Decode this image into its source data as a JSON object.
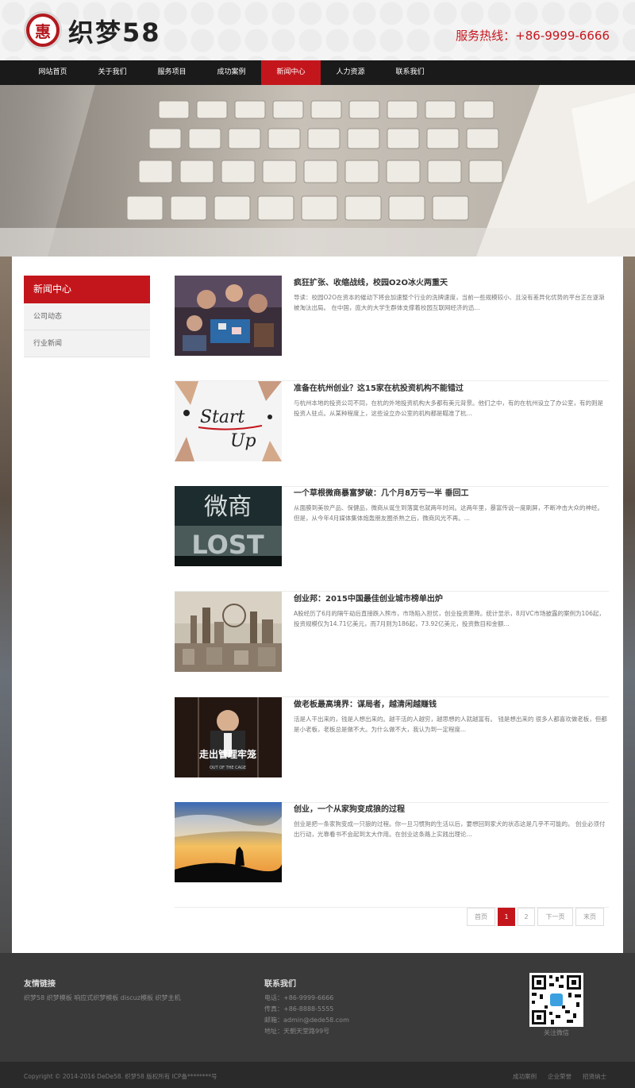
{
  "header": {
    "logo_glyph": "惠",
    "logo_text": "织梦58",
    "hotline": "服务热线：+86-9999-6666"
  },
  "nav": [
    {
      "label": "网站首页"
    },
    {
      "label": "关于我们"
    },
    {
      "label": "服务项目"
    },
    {
      "label": "成功案例"
    },
    {
      "label": "新闻中心",
      "active": true
    },
    {
      "label": "人力资源"
    },
    {
      "label": "联系我们"
    }
  ],
  "sidebar": {
    "title": "新闻中心",
    "items": [
      {
        "label": "公司动态"
      },
      {
        "label": "行业新闻"
      }
    ]
  },
  "news": [
    {
      "title": "疯狂扩张、收缩战线，校园O2O冰火两重天",
      "summary": "导读：校园O2O在资本的催动下将会加速整个行业的洗牌速度，当前一些规模较小、且没有差异化优势的平台正在逐渐被淘汰出局。 在中国，庞大的大学生群体支撑着校园互联网经济的迅..."
    },
    {
      "title": "准备在杭州创业？这15家在杭投资机构不能错过",
      "summary": "与杭州本地的投资公司不同，在杭的外地投资机构大多都有美元背景。他们之中，有的在杭州设立了办公室，有的则是投资人驻点。从某种程度上，这些设立办公室的机构都是瞄准了杭..."
    },
    {
      "title": "一个草根微商暴富梦破：几个月8万亏一半 垂回工",
      "summary": "从面膜到美妆产品、保健品，微商从诞生到落寞也就两年时间。这两年里，暴富传说一度刷屏，不断冲击大众的神经。但是，从今年4月媒体集体炮轰朋友圈杀熟之后，微商风光不再。..."
    },
    {
      "title": "创业邦：2015中国最佳创业城市榜单出炉",
      "summary": "A股经历了6月的隔午劫后直接跌入熊市，市场陷入担忧，创业投资萧降。统计显示，8月VC市场披露的案例为106起，投资规模仅为14.71亿美元，而7月则为186起，73.92亿美元，投资数目和金额..."
    },
    {
      "title": "做老板最高境界：谋局者，越清闲越赚钱",
      "summary": "活是人干出来的，钱是人想出来的。越干活的人越穷，越思想的人就越富有。 钱是想出来的 很多人都喜欢做老板，但都是小老板，老板总是做不大。为什么做不大，我认为到一定程度..."
    },
    {
      "title": "创业，一个从家狗变成狼的过程",
      "summary": "创业是把一条家狗变成一只狼的过程。你一旦习惯狗的生活以后，要想回到家犬的状态这是几乎不可能的。 创业必须付出行动，光靠看书不会起到太大作用。在创业这条路上实践出理论..."
    }
  ],
  "thumbs": {
    "start_up_line1": "Start",
    "start_up_line2": "Up",
    "weishang": "微商",
    "lost": "LOST",
    "cage": "走出管理牢笼",
    "cage_sub": "OUT OF THE CAGE"
  },
  "pagination": {
    "first": "首页",
    "page1": "1",
    "page2": "2",
    "next": "下一页",
    "last": "末页",
    "current_page": 1
  },
  "footer": {
    "links_title": "友情链接",
    "links_text": "织梦58 织梦模板 响应式织梦模板 discuz模板 织梦主机",
    "contact_title": "联系我们",
    "phone": "电话：+86-9999-6666",
    "fax": "传真：+86-8888-5555",
    "email": "邮箱：admin@dede58.com",
    "address": "地址：天朝天堂路99号",
    "qr_caption": "关注微信",
    "copyright": "Copyright © 2014-2016 DeDe58. 织梦58 版权所有   ICP备********号",
    "bottom_links": [
      "成功案例",
      "企业荣誉",
      "招贤纳士"
    ]
  },
  "colors": {
    "brand_red": "#c3161c",
    "nav_bg": "#1a1a1a",
    "footer_bg": "#3a3a3a"
  }
}
